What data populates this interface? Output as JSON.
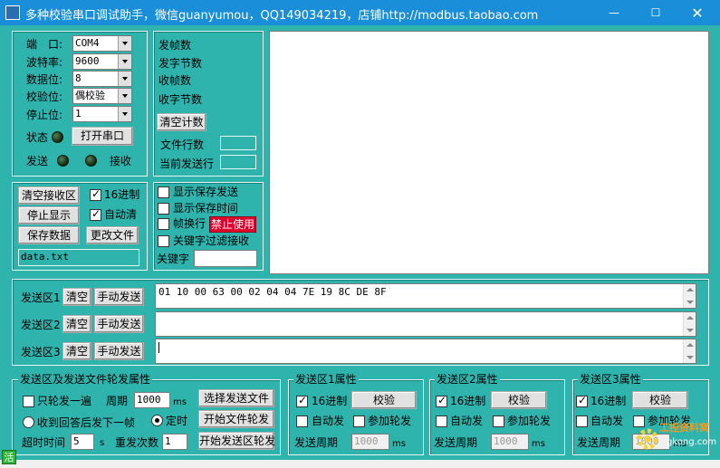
{
  "window": {
    "title": "多种校验串口调试助手，微信guanyumou，QQ149034219，店铺http://modbus.taobao.com",
    "min_glyph": "—",
    "max_glyph": "☐",
    "close_glyph": "✕"
  },
  "port": {
    "port_label": "端　口:",
    "port_value": "COM4",
    "baud_label": "波特率:",
    "baud_value": "9600",
    "databits_label": "数据位:",
    "databits_value": "8",
    "parity_label": "校验位:",
    "parity_value": "偶校验",
    "stopbits_label": "停止位:",
    "stopbits_value": "1",
    "status_label": "状态",
    "open_button": "打开串口",
    "send_label": "发送",
    "recv_label": "接收"
  },
  "counters": {
    "send_frames": "发帧数",
    "send_bytes": "发字节数",
    "recv_frames": "收帧数",
    "recv_bytes": "收字节数",
    "clear_button": "清空计数",
    "file_lines": "文件行数",
    "current_line": "当前发送行"
  },
  "recv_controls": {
    "clear_button": "清空接收区",
    "hex_label": "16进制",
    "stop_button": "停止显示",
    "auto_clear_label": "自动清",
    "save_button": "保存数据",
    "change_file_button": "更改文件",
    "filename": "data.txt"
  },
  "display_options": {
    "show_save_send": "显示保存发送",
    "show_save_time": "显示保存时间",
    "frame_newline": "帧换行",
    "forbidden_badge": "禁止使用",
    "keyword_filter": "关键字过滤接收",
    "keyword_label": "关键字"
  },
  "send_areas": [
    {
      "label": "发送区1",
      "clear": "清空",
      "manual": "手动发送",
      "content": "01 10 00 63 00 02 04 04 7E 19 8C DE 8F"
    },
    {
      "label": "发送区2",
      "clear": "清空",
      "manual": "手动发送",
      "content": ""
    },
    {
      "label": "发送区3",
      "clear": "清空",
      "manual": "手动发送",
      "content": ""
    }
  ],
  "rotation": {
    "title": "发送区及发送文件轮发属性",
    "only_rotate": "只轮发一遍",
    "period_label": "周期",
    "period_value": "1000",
    "ms": "ms",
    "select_file_button": "选择发送文件",
    "after_reply": "收到回答后发下一帧",
    "timed": "定时",
    "start_file_button": "开始文件轮发",
    "timeout_label": "超时时间",
    "timeout_value": "5",
    "s": "s",
    "retry_label": "重发次数",
    "retry_value": "1",
    "start_area_button": "开始发送区轮发"
  },
  "area_props": [
    {
      "title": "发送区1属性",
      "hex": "16进制",
      "verify": "校验",
      "auto": "自动发",
      "join": "参加轮发",
      "period_label": "发送周期",
      "period_value": "1000",
      "ms": "ms"
    },
    {
      "title": "发送区2属性",
      "hex": "16进制",
      "verify": "校验",
      "auto": "自动发",
      "join": "参加轮发",
      "period_label": "发送周期",
      "period_value": "1000",
      "ms": "ms"
    },
    {
      "title": "发送区3属性",
      "hex": "16进制",
      "verify": "校验",
      "auto": "自动发",
      "join": "参加轮发",
      "period_label": "发送周期",
      "period_value": "1000",
      "ms": "ms"
    }
  ],
  "status": {
    "icon_text": "活"
  },
  "watermark": {
    "text1": "工控资料窝",
    "text2": "gkong.com"
  },
  "colors": {
    "titlebar": "#1a8ed8",
    "client": "#2fb3ad",
    "badge": "#e0002a"
  }
}
